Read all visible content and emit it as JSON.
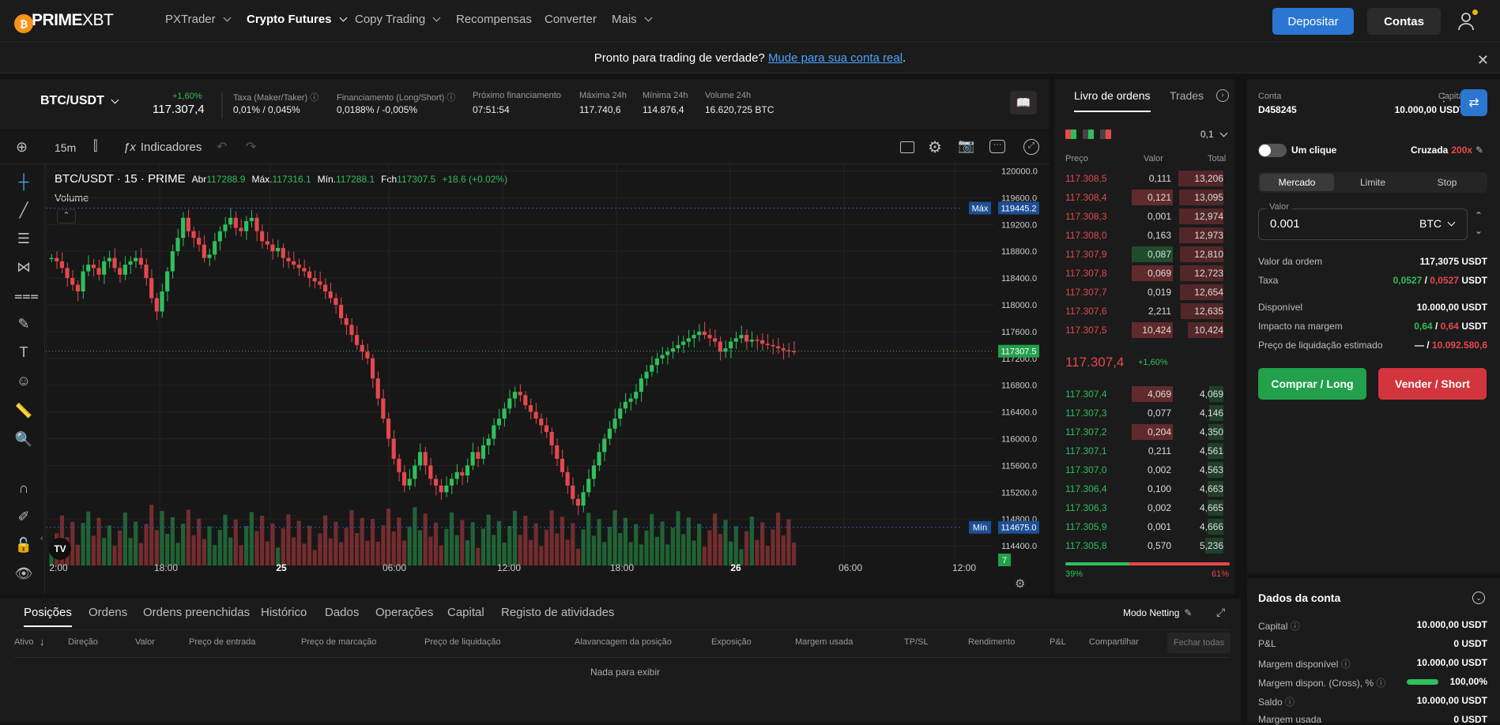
{
  "header": {
    "logo_bold": "PRIME",
    "logo_light": "XBT",
    "nav": [
      {
        "label": "PXTrader",
        "dropdown": true
      },
      {
        "label": "Crypto Futures",
        "dropdown": true,
        "active": true
      },
      {
        "label": "Copy Trading",
        "dropdown": true
      },
      {
        "label": "Recompensas",
        "dropdown": false
      },
      {
        "label": "Converter",
        "dropdown": false
      },
      {
        "label": "Mais",
        "dropdown": true
      }
    ],
    "deposit_label": "Depositar",
    "accounts_label": "Contas",
    "user_icon": "user-icon"
  },
  "banner": {
    "text": "Pronto para trading de verdade?",
    "link": "Mude para sua conta real",
    "end": "."
  },
  "ticker": {
    "symbol": "BTC/USDT",
    "coin_glyph": "₿",
    "change": "+1,60%",
    "price": "117.307,4",
    "fee_label": "Taxa (Maker/Taker)",
    "fee_value": "0,01% / 0,045%",
    "funding_label": "Financiamento (Long/Short)",
    "funding_value": "0,0188% / -0,005%",
    "next_funding_label": "Próximo financiamento",
    "next_funding_value": "07:51:54",
    "high_label": "Máxima 24h",
    "high_value": "117.740,6",
    "low_label": "Mínima 24h",
    "low_value": "114.876,4",
    "volume_label": "Volume 24h",
    "volume_value": "16.620,725 BTC"
  },
  "chart_toolbar": {
    "interval": "15m",
    "indicators_label": "Indicadores"
  },
  "chart_data": {
    "type": "line",
    "title": "BTC/USDT · 15 · PRIME",
    "legend": {
      "open_label": "Abr",
      "open": "117288.9",
      "high_label": "Máx.",
      "high": "117316.1",
      "low_label": "Mín.",
      "low": "117288.1",
      "close_label": "Fch",
      "close": "117307.5",
      "change": "+18.6 (+0.02%)"
    },
    "volume_label": "Volume",
    "y_ticks": [
      "120000.0",
      "119600.0",
      "119200.0",
      "118800.0",
      "118400.0",
      "118000.0",
      "117600.0",
      "117200.0",
      "116800.0",
      "116400.0",
      "116000.0",
      "115600.0",
      "115200.0",
      "114800.0",
      "114400.0"
    ],
    "ylim": [
      114200,
      120100
    ],
    "x_ticks": [
      "2:00",
      "18:00",
      "25",
      "06:00",
      "12:00",
      "18:00",
      "26",
      "06:00",
      "12:00"
    ],
    "max_label": "Máx",
    "max_value": "119445.2",
    "min_label": "Mín",
    "min_value": "114675.0",
    "last_price": "117307.5",
    "countdown": "7",
    "series": [
      {
        "values": [
          118700,
          118650,
          118550,
          118400,
          118300,
          118200,
          118500,
          118600,
          118550,
          118450,
          118650,
          118700,
          118550,
          118450,
          118600,
          118650,
          118700,
          118600,
          118400,
          118100,
          117900,
          118200,
          118500,
          118800,
          119000,
          119300,
          119100,
          119000,
          118900,
          118700,
          118750,
          118950,
          119100,
          119200,
          119300,
          119150,
          119100,
          119250,
          119300,
          119100,
          118950,
          118900,
          118800,
          118850,
          118700,
          118650,
          118600,
          118550,
          118500,
          118400,
          118350,
          118300,
          118200,
          118100,
          118000,
          117800,
          117700,
          117550,
          117400,
          117300,
          117200,
          116900,
          116600,
          116300,
          116000,
          115700,
          115500,
          115300,
          115400,
          115600,
          115800,
          115600,
          115400,
          115300,
          115200,
          115300,
          115400,
          115500,
          115450,
          115600,
          115800,
          115700,
          115900,
          116000,
          116200,
          116300,
          116450,
          116600,
          116700,
          116650,
          116500,
          116400,
          116300,
          116200,
          116100,
          115900,
          115700,
          115500,
          115300,
          115100,
          115000,
          115200,
          115400,
          115600,
          115800,
          116000,
          116150,
          116300,
          116450,
          116550,
          116600,
          116700,
          116900,
          117000,
          117100,
          117200,
          117250,
          117300,
          117350,
          117400,
          117450,
          117500,
          117550,
          117600,
          117550,
          117500,
          117450,
          117300,
          117350,
          117450,
          117500,
          117550,
          117450,
          117480,
          117470,
          117420,
          117400,
          117380,
          117350,
          117320,
          117310,
          117307
        ]
      }
    ]
  },
  "orderbook": {
    "tab_book": "Livro de ordens",
    "tab_trades": "Trades",
    "step": "0,1",
    "col_price": "Preço",
    "col_value": "Valor",
    "col_total": "Total",
    "asks": [
      {
        "price": "117.308,5",
        "value": "0,111",
        "total": "13,206",
        "fill": 0.95
      },
      {
        "price": "117.308,4",
        "value": "0,121",
        "total": "13,095",
        "fill": 0.94,
        "hl": true
      },
      {
        "price": "117.308,3",
        "value": "0,001",
        "total": "12,974",
        "fill": 0.93
      },
      {
        "price": "117.308,0",
        "value": "0,163",
        "total": "12,973",
        "fill": 0.93
      },
      {
        "price": "117.307,9",
        "value": "0,087",
        "total": "12,810",
        "fill": 0.92,
        "hlg": true
      },
      {
        "price": "117.307,8",
        "value": "0,069",
        "total": "12,723",
        "fill": 0.91,
        "hl": true
      },
      {
        "price": "117.307,7",
        "value": "0,019",
        "total": "12,654",
        "fill": 0.91
      },
      {
        "price": "117.307,6",
        "value": "2,211",
        "total": "12,635",
        "fill": 0.9
      },
      {
        "price": "117.307,5",
        "value": "10,424",
        "total": "10,424",
        "fill": 0.75,
        "hl": true
      }
    ],
    "mid_price": "117.307,4",
    "mid_change": "+1,60%",
    "bids": [
      {
        "price": "117.307,4",
        "value": "4,069",
        "total": "4,069",
        "fill": 0.3,
        "hl": true
      },
      {
        "price": "117.307,3",
        "value": "0,077",
        "total": "4,146",
        "fill": 0.3
      },
      {
        "price": "117.307,2",
        "value": "0,204",
        "total": "4,350",
        "fill": 0.31,
        "hl": true
      },
      {
        "price": "117.307,1",
        "value": "0,211",
        "total": "4,561",
        "fill": 0.33
      },
      {
        "price": "117.307,0",
        "value": "0,002",
        "total": "4,563",
        "fill": 0.33
      },
      {
        "price": "117.306,4",
        "value": "0,100",
        "total": "4,663",
        "fill": 0.34
      },
      {
        "price": "117.306,3",
        "value": "0,002",
        "total": "4,665",
        "fill": 0.34
      },
      {
        "price": "117.305,9",
        "value": "0,001",
        "total": "4,666",
        "fill": 0.34
      },
      {
        "price": "117.305,8",
        "value": "0,570",
        "total": "5,236",
        "fill": 0.38
      }
    ],
    "buy_pct": "39%",
    "sell_pct": "61%",
    "buy_ratio": 0.39
  },
  "order_form": {
    "account_label": "Conta",
    "account_id": "D458245",
    "capital_label": "Capital",
    "capital_value": "10.000,00 USDT",
    "one_click": "Um clique",
    "margin_mode": "Cruzada",
    "leverage": "200x",
    "tabs": [
      "Mercado",
      "Limite",
      "Stop"
    ],
    "amount_label": "Valor",
    "amount": "0.001",
    "unit": "BTC",
    "rows": [
      {
        "label": "Valor da ordem",
        "value": "117,3075 USDT"
      },
      {
        "label": "Disponível",
        "value": "10.000,00 USDT"
      }
    ],
    "fee_label": "Taxa",
    "fee_buy": "0,0527",
    "fee_sell": "0,0527",
    "fee_unit": "USDT",
    "impact_label": "Impacto na margem",
    "impact_buy": "0,64",
    "impact_sell": "0,64",
    "liq_label": "Preço de liquidação estimado",
    "liq_buy": "—",
    "liq_sell": "10.092.580,6",
    "buy_label": "Comprar / Long",
    "sell_label": "Vender / Short"
  },
  "account_data": {
    "title": "Dados da conta",
    "rows": [
      {
        "label": "Capital",
        "value": "10.000,00 USDT"
      },
      {
        "label": "P&L",
        "value": "0 USDT"
      },
      {
        "label": "Margem disponível",
        "value": "10.000,00 USDT"
      },
      {
        "label": "Margem dispon. (Cross), %",
        "value": "100,00%"
      },
      {
        "label": "Saldo",
        "value": "10.000,00 USDT"
      },
      {
        "label": "Margem usada",
        "value": "0 USDT"
      }
    ],
    "cross_margin_ratio": 1.0
  },
  "bottom": {
    "tabs": [
      "Posições",
      "Ordens",
      "Ordens preenchidas",
      "Histórico",
      "Dados",
      "Operações",
      "Capital",
      "Registo de atividades"
    ],
    "netting": "Modo Netting",
    "columns": [
      "Ativo",
      "Direção",
      "Valor",
      "Preço de entrada",
      "Preço de marcação",
      "Preço de liquidação",
      "Alavancagem da posição",
      "Exposição",
      "Margem usada",
      "TP/SL",
      "Rendimento",
      "P&L",
      "Compartilhar"
    ],
    "close_all": "Fechar todas",
    "empty": "Nada para exibir"
  },
  "colors": {
    "green": "#2fbf5c",
    "red": "#e5484d",
    "accent": "#2a76d2"
  }
}
